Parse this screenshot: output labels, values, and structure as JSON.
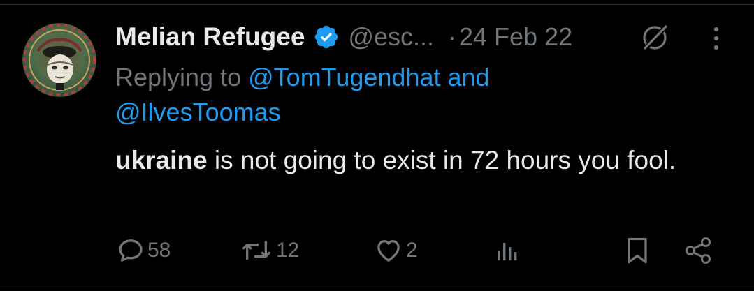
{
  "tweet": {
    "author_name": "Melian Refugee",
    "handle": "@esc...",
    "separator": "·",
    "date": "24 Feb 22",
    "replying_prefix": "Replying to",
    "mention_1": "@TomTugendhat",
    "mention_join": "and",
    "mention_2": "@IlvesToomas",
    "text_bold": "ukraine",
    "text_rest": " is not going to exist in 72 hours you fool."
  },
  "actions": {
    "replies": "58",
    "reposts": "12",
    "likes": "2"
  },
  "colors": {
    "background": "#000000",
    "text": "#e7e9ea",
    "muted": "#71767b",
    "accent": "#1d9bf0",
    "divider": "#2f3336"
  },
  "icons": [
    "verified-badge-icon",
    "grok-icon",
    "more-icon",
    "reply-icon",
    "repost-icon",
    "like-icon",
    "views-icon",
    "bookmark-icon",
    "share-icon"
  ]
}
